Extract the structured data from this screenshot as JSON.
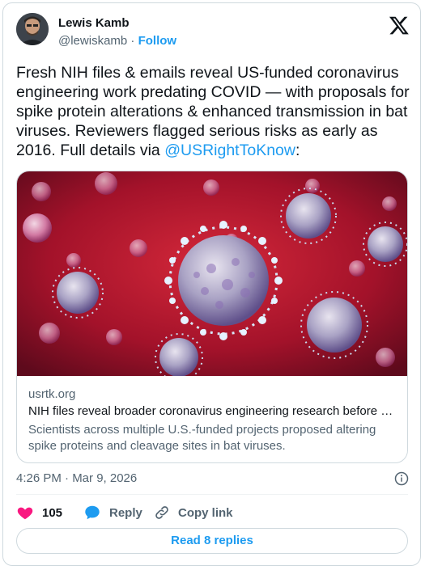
{
  "author": {
    "name": "Lewis Kamb",
    "handle": "@lewiskamb",
    "separator": "·",
    "follow_label": "Follow"
  },
  "tweet": {
    "text": "Fresh NIH files & emails reveal US-funded coronavirus engineering work predating COVID — with proposals for spike protein alterations & enhanced transmission in bat viruses. Reviewers flagged serious risks as early as 2016. Full details via ",
    "mention": "@USRightToKnow",
    "text_end": ":"
  },
  "link_card": {
    "domain": "usrtk.org",
    "title": "NIH files reveal broader coronavirus engineering research before COVID",
    "description": "Scientists across multiple U.S.-funded projects proposed altering spike proteins and cleavage sites in bat viruses.",
    "image_icon": "coronavirus-image"
  },
  "timestamp": "4:26 PM · Mar 9, 2026",
  "actions": {
    "likes": "105",
    "reply_label": "Reply",
    "copy_link_label": "Copy link"
  },
  "read_replies_label": "Read 8 replies",
  "colors": {
    "accent": "#1d9bf0",
    "like": "#f91880",
    "text": "#0f1419",
    "secondary": "#536471",
    "border": "#cfd9de"
  }
}
